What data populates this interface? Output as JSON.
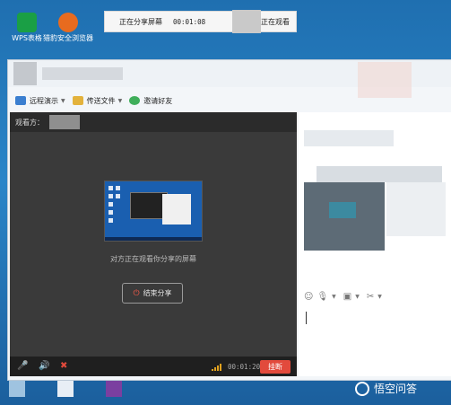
{
  "desktop": {
    "icons": [
      {
        "label": "WPS表格",
        "icon": "wps-spreadsheet-icon",
        "color": "#1a9f45"
      },
      {
        "label": "猎豹安全浏览器",
        "icon": "cheetah-browser-icon",
        "color": "#e86b1f"
      }
    ],
    "bottom_icons": [
      {
        "label": "",
        "icon": "recycle-bin-icon"
      },
      {
        "label": "",
        "icon": "document-file-icon"
      },
      {
        "label": "",
        "icon": "winrar-archive-icon"
      }
    ]
  },
  "share_bar": {
    "status_label": "正在分享屏幕",
    "elapsed": "00:01:08",
    "watching_label": "正在观看"
  },
  "toolbar": {
    "remote_demo": "远程演示",
    "send_file": "传送文件",
    "invite_friend": "邀请好友"
  },
  "viewer": {
    "watcher_label": "观看方：",
    "sharing_message": "对方正在观看你分享的屏幕",
    "end_share_button": "结束分享",
    "call_time": "00:01:20",
    "hangup_button": "挂断"
  },
  "watermark": {
    "text": "悟空问答"
  },
  "colors": {
    "desktop_bg": "#2a85c8",
    "viewer_bg": "#3a3a3a",
    "hangup": "#e24a3c",
    "signal": "#e2a21e"
  }
}
